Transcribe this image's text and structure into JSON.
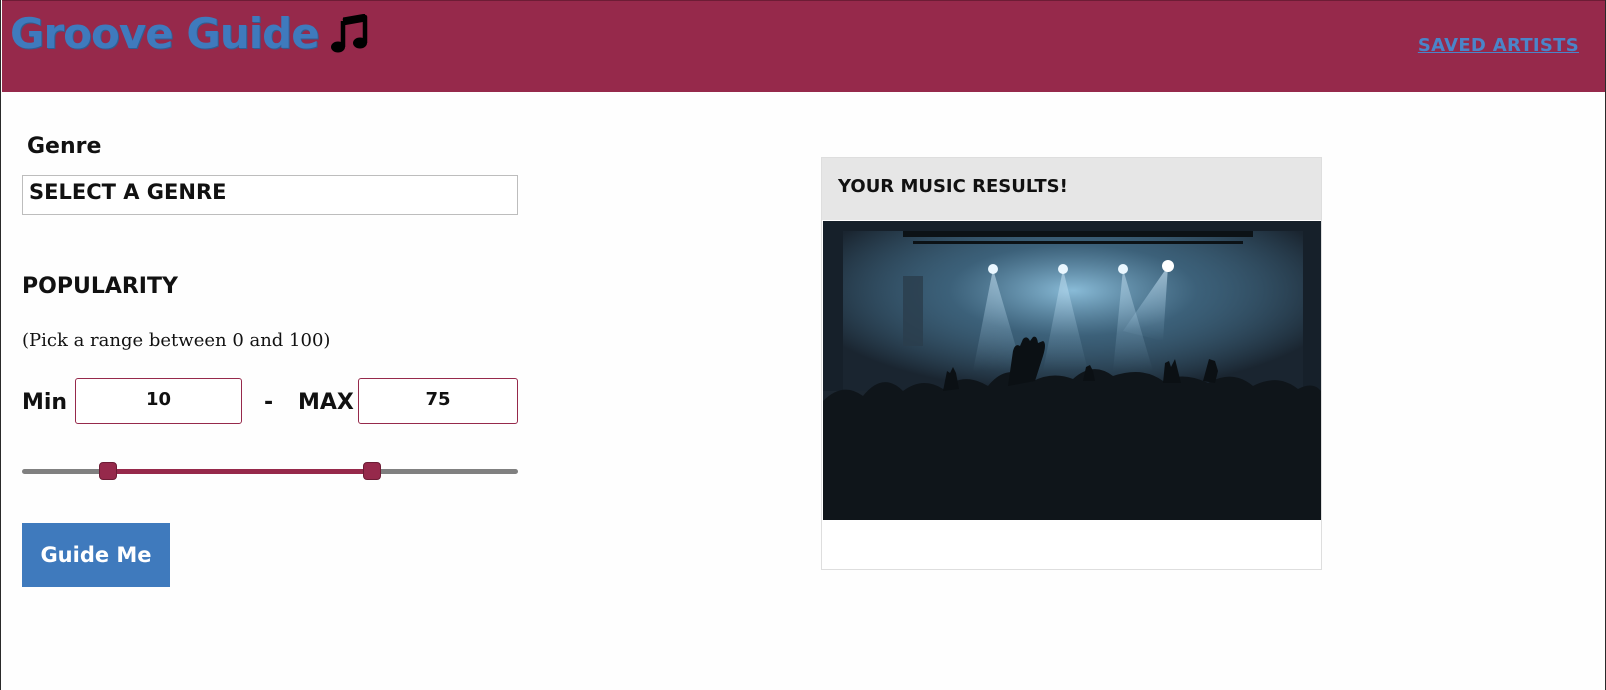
{
  "header": {
    "title": "Groove Guide",
    "title_icon": "music-note-icon",
    "nav_link": "Saved Artists",
    "bg_color": "#96294b",
    "title_color": "#3f7abd"
  },
  "form": {
    "genre_label": "Genre",
    "genre_value": "Select a Genre",
    "popularity_label": "Popularity",
    "hint": "(Pick a range between 0 and 100)",
    "min_label": "Min",
    "max_label": "Max",
    "separator": "-",
    "min_value": "10",
    "max_value": "75",
    "range_min": 0,
    "range_max": 100,
    "button_label": "Guide me",
    "button_color": "#3f7abd"
  },
  "results": {
    "title": "Your Music Results!",
    "image": "concert-crowd-image"
  }
}
